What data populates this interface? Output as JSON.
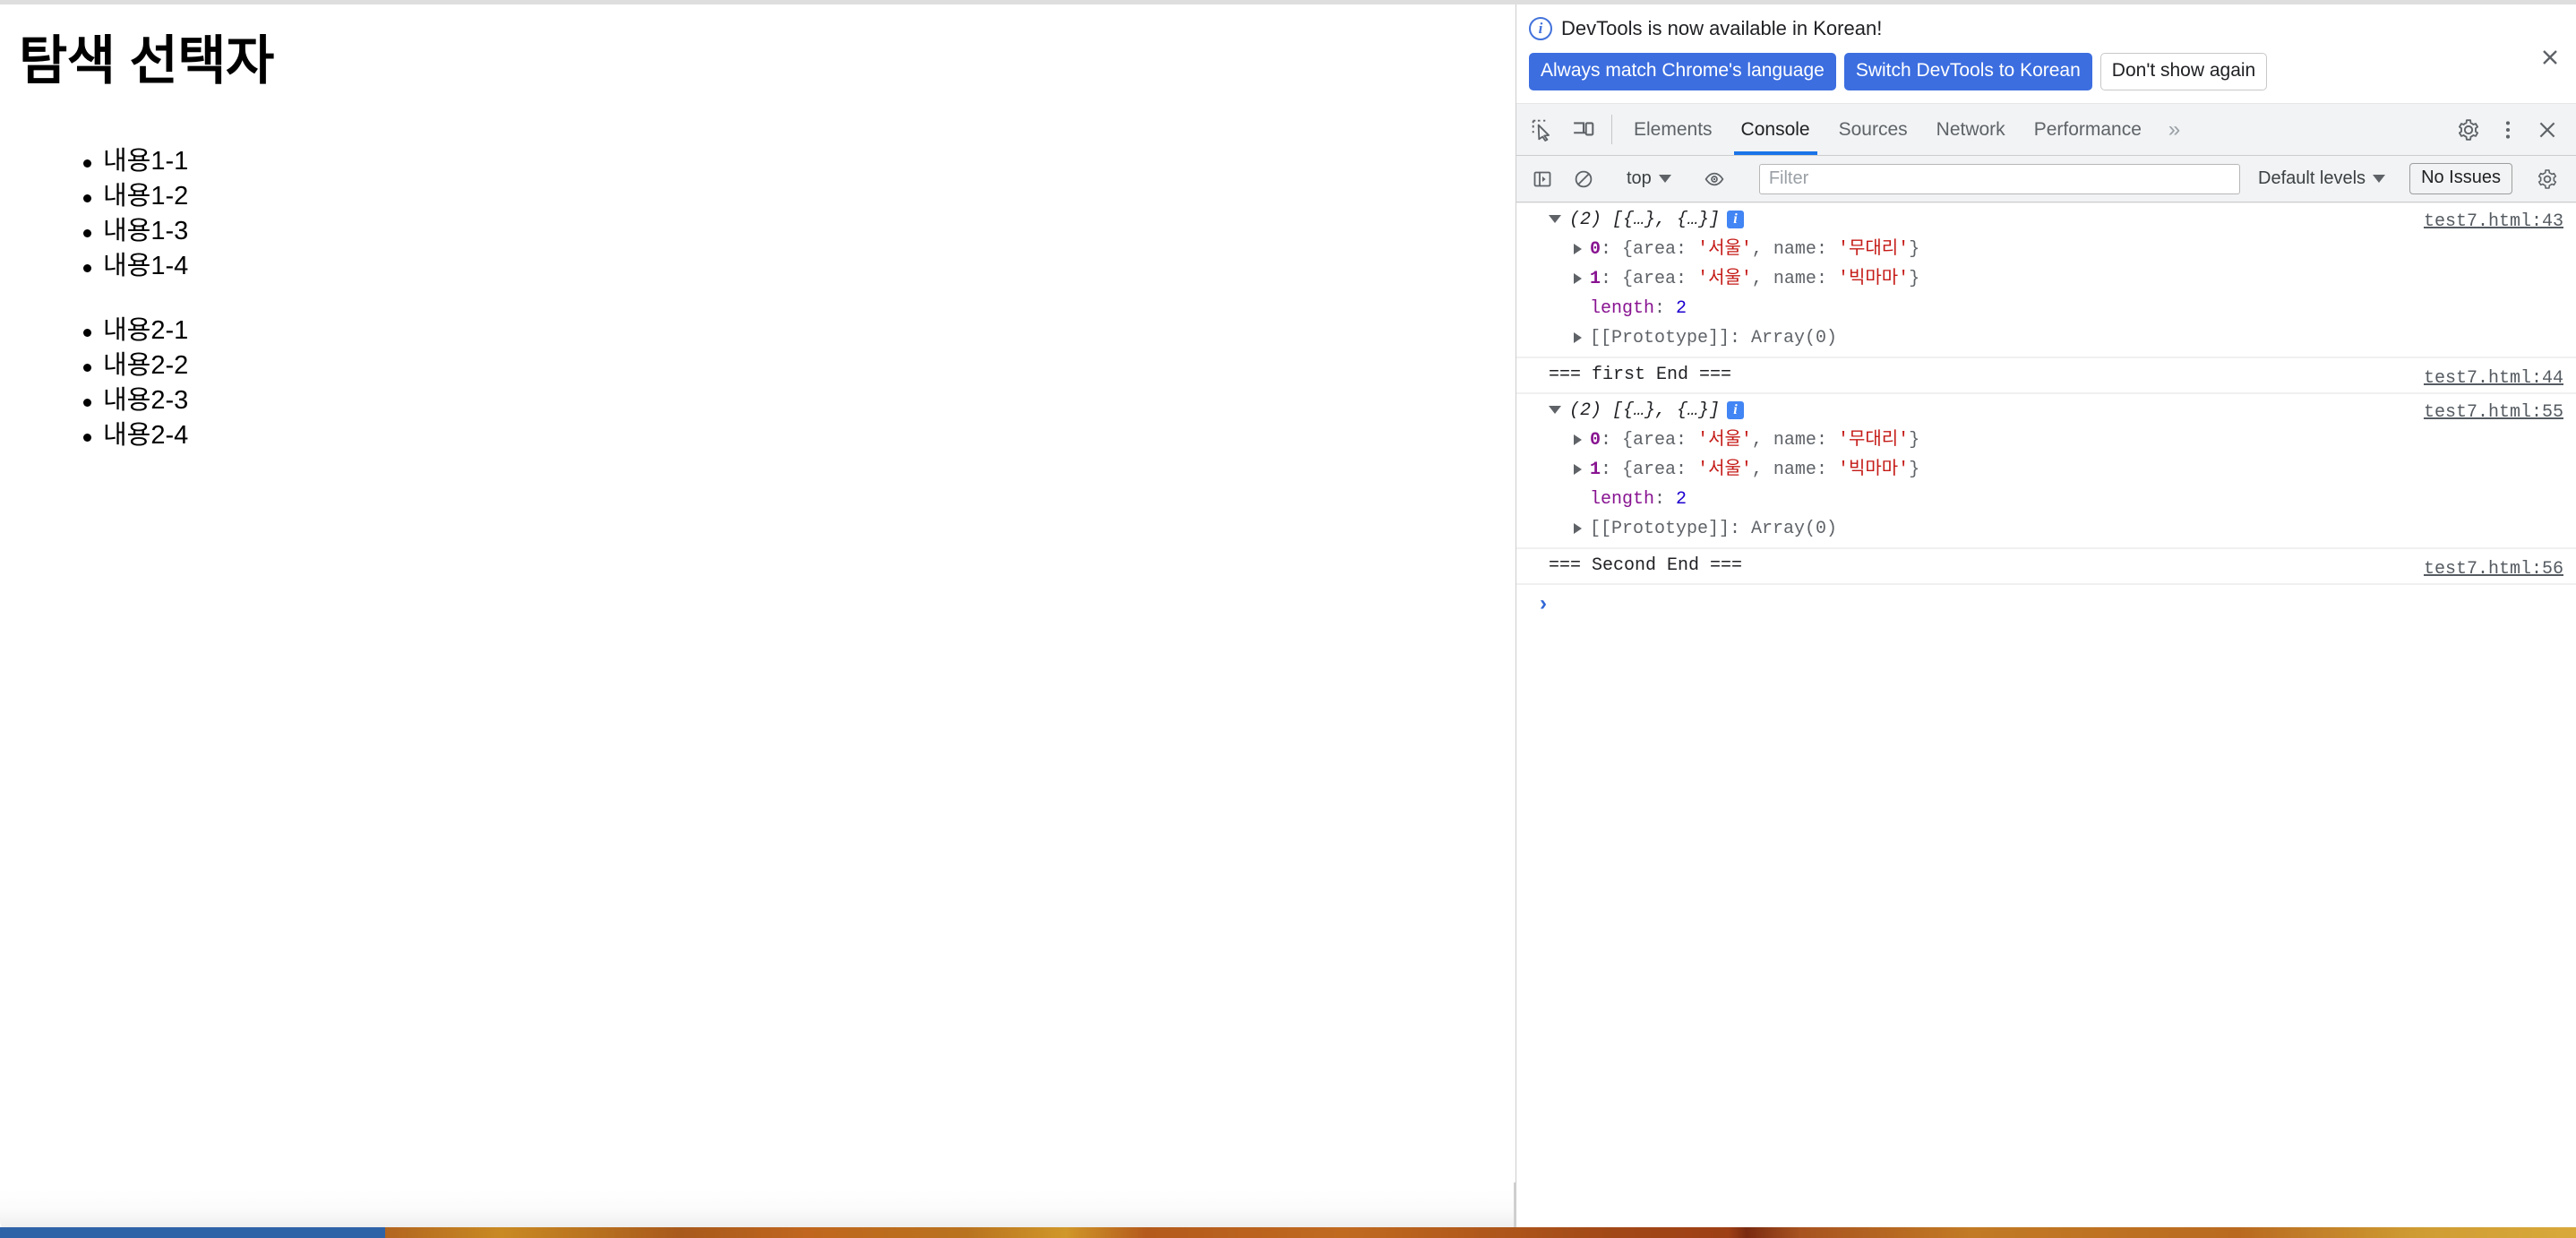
{
  "page": {
    "title": "탐색 선택자",
    "list_group_1": [
      "내용1-1",
      "내용1-2",
      "내용1-3",
      "내용1-4"
    ],
    "list_group_2": [
      "내용2-1",
      "내용2-2",
      "내용2-3",
      "내용2-4"
    ]
  },
  "devtools": {
    "banner": {
      "icon": "info-icon",
      "message": "DevTools is now available in Korean!",
      "primary_button_1": "Always match Chrome's language",
      "primary_button_2": "Switch DevTools to Korean",
      "secondary_button": "Don't show again",
      "close_icon": "close-icon"
    },
    "tabs": {
      "inspect_icon": "inspect-element-icon",
      "device_icon": "device-toolbar-icon",
      "items": [
        {
          "label": "Elements",
          "active": false
        },
        {
          "label": "Console",
          "active": true
        },
        {
          "label": "Sources",
          "active": false
        },
        {
          "label": "Network",
          "active": false
        },
        {
          "label": "Performance",
          "active": false
        }
      ],
      "more_label": "»",
      "settings_icon": "gear-icon",
      "kebab_icon": "more-vertical-icon",
      "close_icon": "close-icon"
    },
    "filterbar": {
      "sidebar_icon": "console-sidebar-icon",
      "clear_icon": "clear-console-icon",
      "context": "top",
      "eye_icon": "live-expression-eye-icon",
      "filter_value": "",
      "filter_placeholder": "Filter",
      "levels_label": "Default levels",
      "issues_label": "No Issues",
      "settings_icon": "gear-icon"
    },
    "console": {
      "prompt_chevron": "›",
      "groups": [
        {
          "type": "array",
          "header": "(2) [{…}, {…}]",
          "badge": "i",
          "source": "test7.html:43",
          "entries": [
            {
              "index": "0",
              "area": "서울",
              "name": "무대리"
            },
            {
              "index": "1",
              "area": "서울",
              "name": "빅마마"
            }
          ],
          "length_key": "length",
          "length_value": "2",
          "proto_key": "[[Prototype]]",
          "proto_value": "Array(0)"
        },
        {
          "type": "text",
          "text": "=== first End ===",
          "source": "test7.html:44"
        },
        {
          "type": "array",
          "header": "(2) [{…}, {…}]",
          "badge": "i",
          "source": "test7.html:55",
          "entries": [
            {
              "index": "0",
              "area": "서울",
              "name": "무대리"
            },
            {
              "index": "1",
              "area": "서울",
              "name": "빅마마"
            }
          ],
          "length_key": "length",
          "length_value": "2",
          "proto_key": "[[Prototype]]",
          "proto_value": "Array(0)"
        },
        {
          "type": "text",
          "text": "=== Second End ===",
          "source": "test7.html:56"
        }
      ],
      "labels": {
        "key_area": "area",
        "key_name": "name",
        "colon": ": ",
        "comma": ", ",
        "brace_open": "{",
        "brace_close": "}",
        "quote": "'"
      }
    }
  },
  "colors": {
    "accent_blue": "#1a73e8",
    "button_blue": "#3c6ee0",
    "string_red": "#c41a16",
    "key_purple": "#881391",
    "number_blue": "#1c00cf",
    "toolbar_gray": "#f1f3f4"
  }
}
